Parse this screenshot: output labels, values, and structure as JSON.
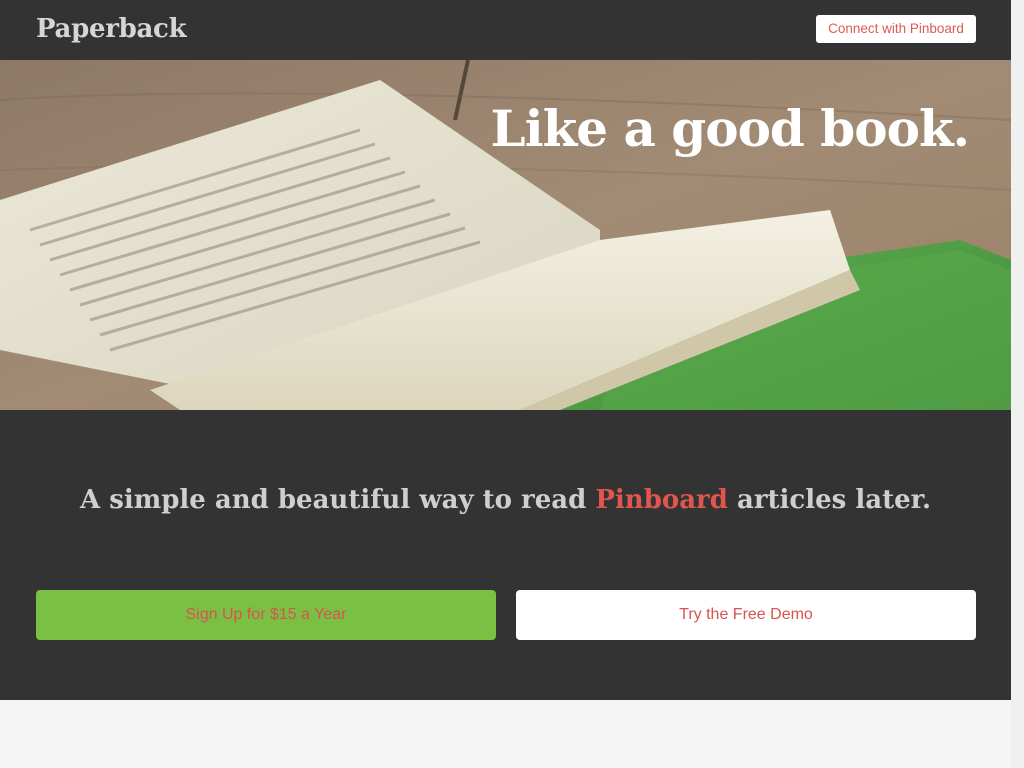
{
  "header": {
    "logo": "Paperback",
    "connect_label": "Connect with Pinboard"
  },
  "hero": {
    "heading": "Like a good book."
  },
  "main": {
    "tagline_before": "A simple and beautiful way to read ",
    "tagline_accent": "Pinboard",
    "tagline_after": " articles later.",
    "signup_label": "Sign Up for $15 a Year",
    "demo_label": "Try the Free Demo"
  },
  "colors": {
    "header_bg": "#333333",
    "accent_red": "#e0554c",
    "signup_green": "#7ac143",
    "page_bg": "#f5f5f5"
  }
}
